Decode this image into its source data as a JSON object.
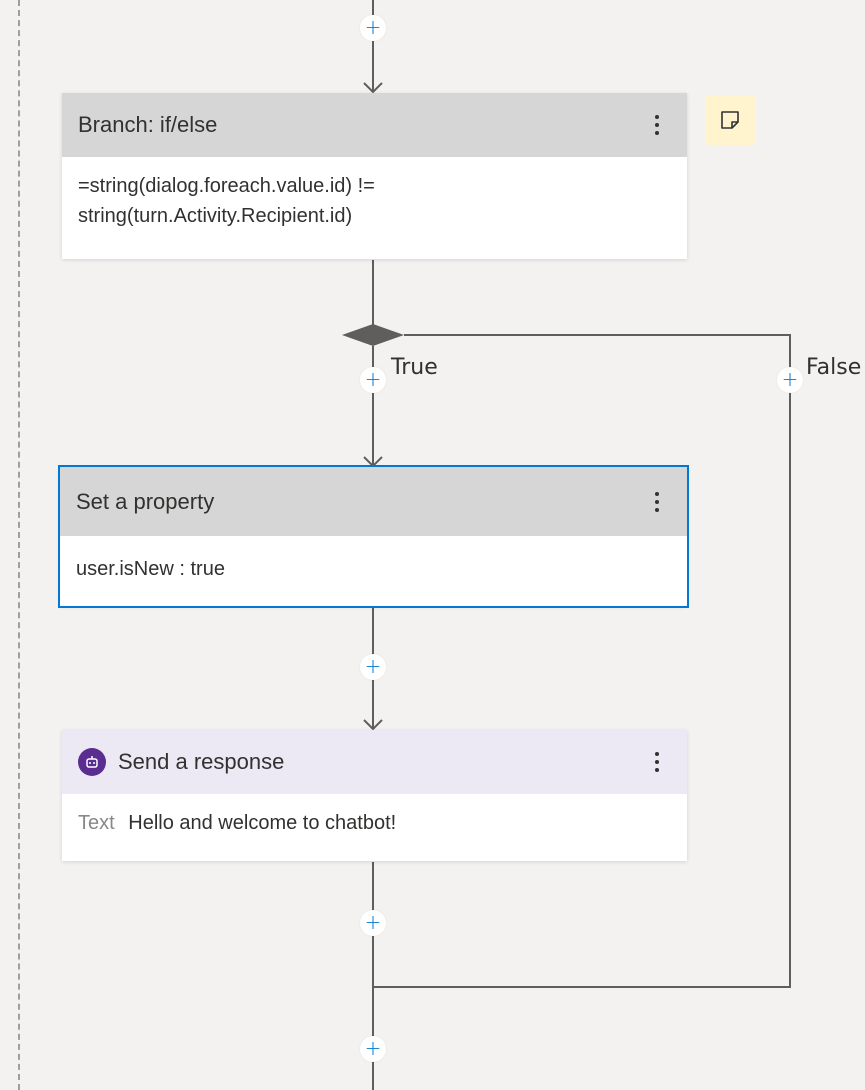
{
  "branch_node": {
    "title": "Branch: if/else",
    "condition_line1": "=string(dialog.foreach.value.id) !=",
    "condition_line2": "string(turn.Activity.Recipient.id)"
  },
  "branches": {
    "true_label": "True",
    "false_label": "False"
  },
  "set_property_node": {
    "title": "Set a property",
    "assignment": "user.isNew : true"
  },
  "send_response_node": {
    "title": "Send a response",
    "field_label": "Text",
    "field_value": "Hello and welcome to chatbot!"
  },
  "add_button_glyph": "+",
  "icons": {
    "more_options": "more-vertical-icon",
    "note": "note-icon",
    "bot": "bot-icon"
  },
  "colors": {
    "accent": "#0078d4",
    "header_gray": "#d6d6d6",
    "header_purple": "#ede9f4",
    "bot_purple": "#5c2d91",
    "note_yellow": "#fff4ce",
    "edge": "#605e5c"
  }
}
